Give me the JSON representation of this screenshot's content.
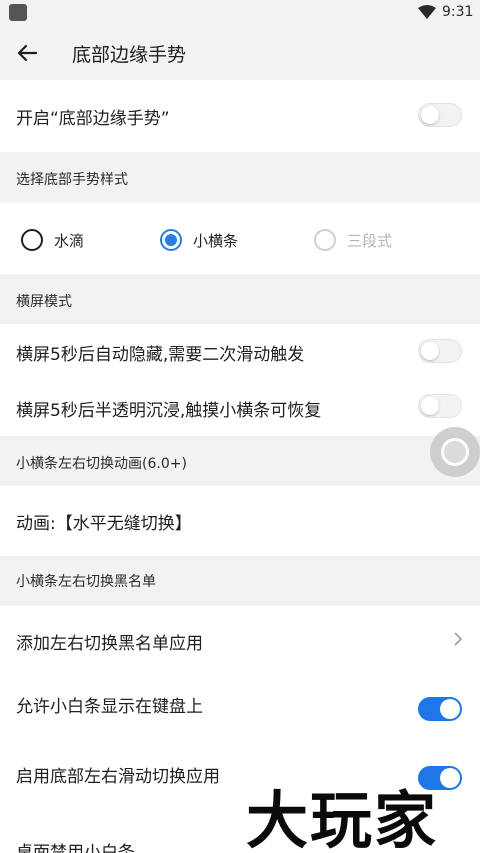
{
  "status": {
    "time": "9:31"
  },
  "appbar": {
    "title": "底部边缘手势"
  },
  "main_toggle": {
    "label": "开启“底部边缘手势”",
    "on": false
  },
  "section_style": {
    "title": "选择底部手势样式"
  },
  "radios": [
    {
      "label": "水滴",
      "checked": false,
      "disabled": false
    },
    {
      "label": "小横条",
      "checked": true,
      "disabled": false
    },
    {
      "label": "三段式",
      "checked": false,
      "disabled": true
    }
  ],
  "section_landscape": {
    "title": "横屏模式"
  },
  "landscape_items": [
    {
      "label": "横屏5秒后自动隐藏,需要二次滑动触发",
      "on": false
    },
    {
      "label": "横屏5秒后半透明沉浸,触摸小横条可恢复",
      "on": false
    }
  ],
  "section_anim": {
    "title": "小横条左右切换动画(6.0+)"
  },
  "anim_item": {
    "label": "动画:【水平无缝切换】"
  },
  "section_blacklist": {
    "title": "小横条左右切换黑名单"
  },
  "blacklist_item": {
    "label": "添加左右切换黑名单应用"
  },
  "keyboard_item": {
    "label": "允许小白条显示在键盘上",
    "on": true
  },
  "swipe_item": {
    "label": "启用底部左右滑动切换应用",
    "on": true
  },
  "desktop_item": {
    "label": "桌面禁用小白条"
  },
  "watermark": {
    "text": "大玩家"
  },
  "colors": {
    "accent": "#1f76e6",
    "section_bg": "#f2f2f2"
  }
}
